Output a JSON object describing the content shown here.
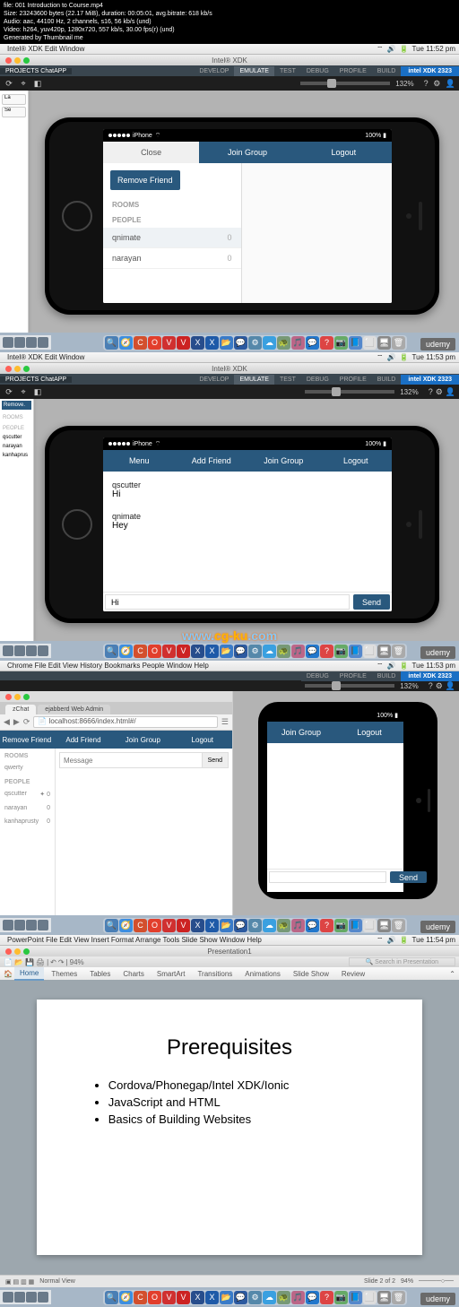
{
  "video_info": {
    "file": "file: 001 Introduction to Course.mp4",
    "size": "Size: 23243600 bytes (22.17 MiB), duration: 00:05:01, avg.bitrate: 618 kb/s",
    "audio": "Audio: aac, 44100 Hz, 2 channels, s16, 56 kb/s (und)",
    "video": "Video: h264, yuv420p, 1280x720, 557 kb/s, 30.00 fps(r) (und)",
    "thumb": "Generated by Thumbnail me"
  },
  "menubar": {
    "app1": "Intel® XDK  Edit  Window",
    "app2": "Intel® XDK  Edit  Window",
    "app3": "Chrome  File  Edit  View  History  Bookmarks  People  Window  Help",
    "app4": "PowerPoint  File  Edit  View  Insert  Format  Arrange  Tools  Slide Show  Window  Help",
    "time1": "Tue 11:52 pm",
    "time2": "Tue 11:53 pm",
    "time3": "Tue 11:53 pm",
    "time4": "Tue 11:54 pm",
    "apple": ""
  },
  "xdk": {
    "title": "Intel® XDK",
    "project": "PROJECTS  ChatAPP",
    "tabs": [
      "DEVELOP",
      "EMULATE",
      "TEST",
      "DEBUG",
      "PROFILE",
      "BUILD"
    ],
    "brand": "intel XDK 2323",
    "zoom": "132%"
  },
  "phone_status": {
    "carrier": "iPhone",
    "battery": "100%"
  },
  "screen1": {
    "close": "Close",
    "join": "Join Group",
    "logout": "Logout",
    "remove": "Remove Friend",
    "rooms": "ROOMS",
    "people": "PEOPLE",
    "rows": [
      {
        "name": "qnimate",
        "count": "0"
      },
      {
        "name": "narayan",
        "count": "0"
      }
    ]
  },
  "screen2": {
    "menu": "Menu",
    "addfriend": "Add Friend",
    "join": "Join Group",
    "logout": "Logout",
    "messages": [
      {
        "user": "qscutter",
        "text": "Hi"
      },
      {
        "user": "qnimate",
        "text": "Hey"
      }
    ],
    "input_value": "Hi",
    "send": "Send"
  },
  "watermark": "www.cg-ku.com",
  "chrome": {
    "tabs": [
      "zChat",
      "ejabberd Web Admin"
    ],
    "url": "localhost:8666/index.html#/",
    "nav": {
      "remove": "Remove Friend",
      "add": "Add Friend",
      "join": "Join Group",
      "logout": "Logout"
    },
    "side": {
      "rooms": "ROOMS",
      "room1": "qwerty",
      "people": "PEOPLE",
      "p1": "qscutter",
      "p1c": "0",
      "p2": "narayan",
      "p2c": "0",
      "p3": "kanhaprusty",
      "p3c": "0"
    },
    "placeholder": "Message",
    "send": "Send"
  },
  "screen3": {
    "join": "Join Group",
    "logout": "Logout",
    "send": "Send"
  },
  "powerpoint": {
    "doc_title": "Presentation1",
    "toolbar_zoom": "94%",
    "ribbon_tabs": [
      "Home",
      "Themes",
      "Tables",
      "Charts",
      "SmartArt",
      "Transitions",
      "Animations",
      "Slide Show",
      "Review"
    ],
    "slide_title": "Prerequisites",
    "bullets": [
      "Cordova/Phonegap/Intel XDK/Ionic",
      "JavaScript and HTML",
      "Basics of Building Websites"
    ],
    "status_left": "Normal View",
    "status_right": "Slide 2 of 2",
    "status_zoom": "94%"
  },
  "udemy": "udemy",
  "left_btns": [
    "La",
    "Se"
  ]
}
